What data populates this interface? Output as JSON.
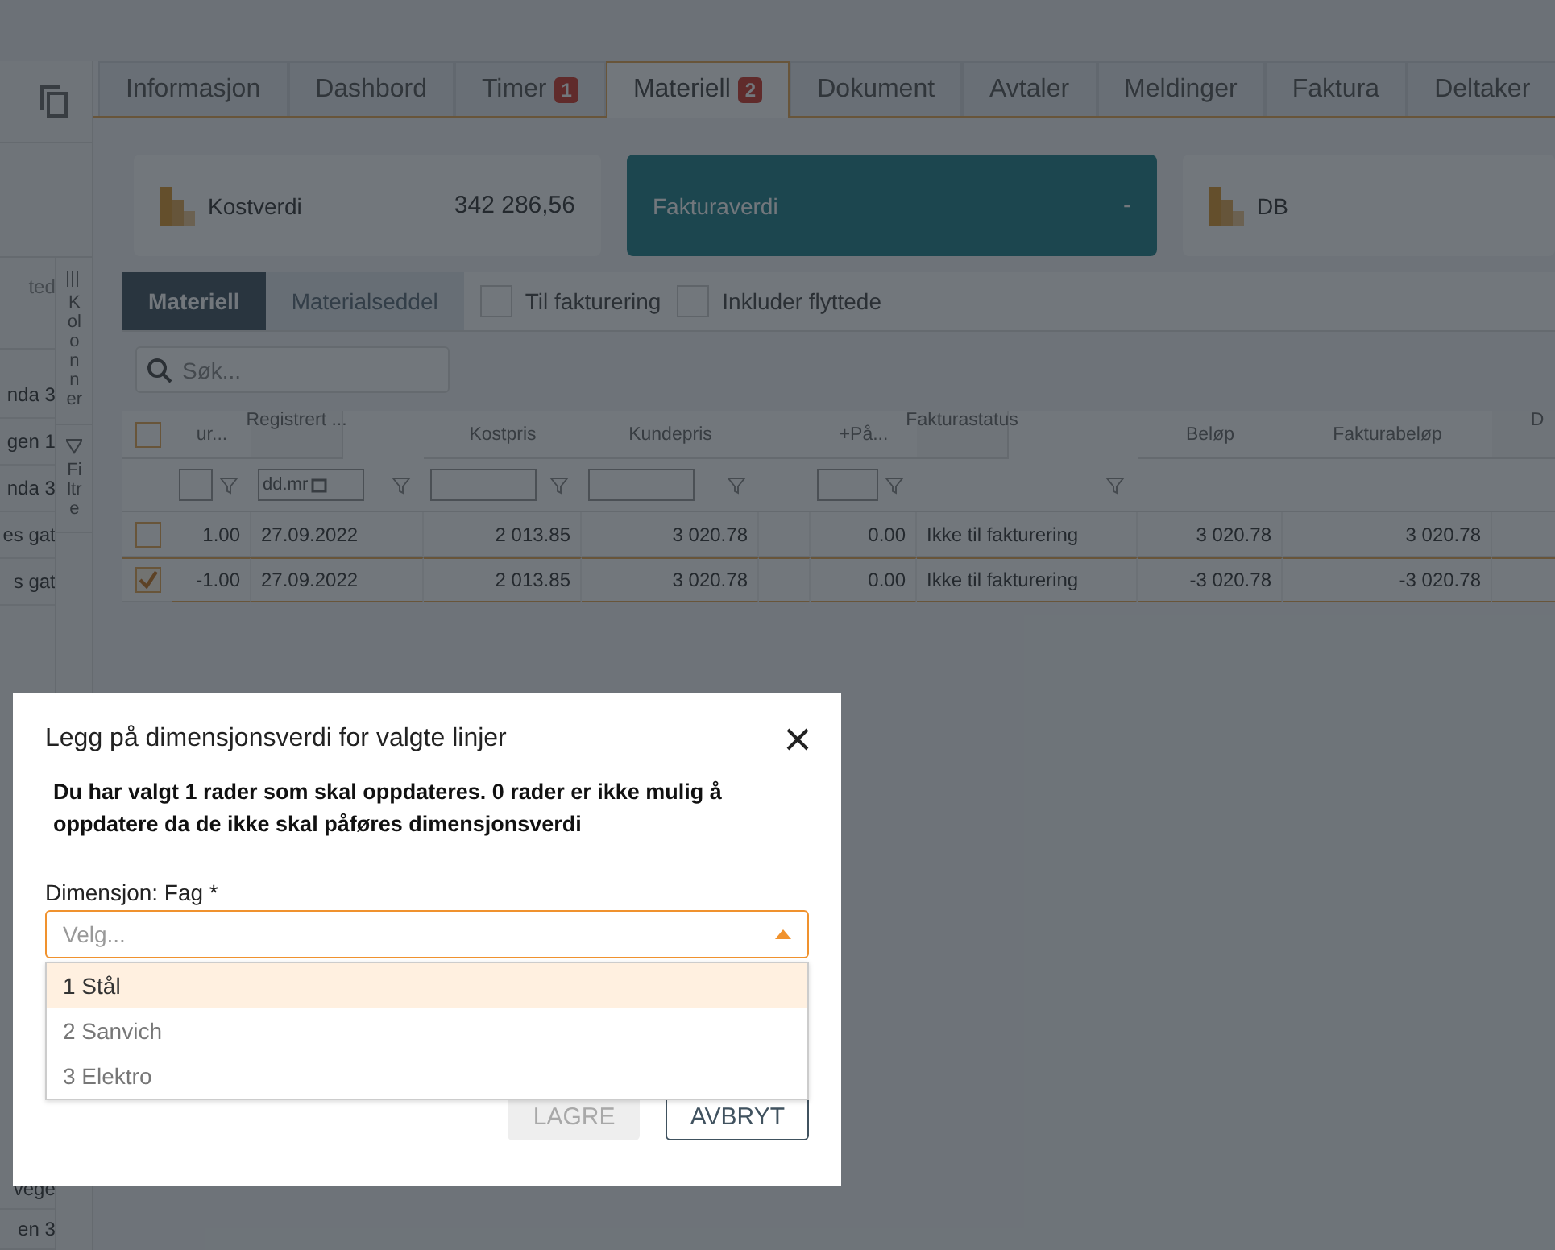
{
  "sidebar": {
    "header": "ted",
    "items": [
      "nda 3",
      "gen 1",
      "nda 3",
      "es gat",
      "s gat"
    ],
    "bottom_items": [
      "vege",
      "en 3"
    ],
    "side_tabs": [
      {
        "label": "Kolonner",
        "kind": "columns"
      },
      {
        "label": "Filtre",
        "kind": "filter"
      }
    ]
  },
  "tabs": [
    {
      "label": "Informasjon",
      "selected": false
    },
    {
      "label": "Dashbord",
      "selected": false
    },
    {
      "label": "Timer",
      "badge": "1",
      "selected": false
    },
    {
      "label": "Materiell",
      "badge": "2",
      "selected": true
    },
    {
      "label": "Dokument",
      "selected": false
    },
    {
      "label": "Avtaler",
      "selected": false
    },
    {
      "label": "Meldinger",
      "selected": false
    },
    {
      "label": "Faktura",
      "selected": false
    },
    {
      "label": "Deltaker",
      "selected": false
    }
  ],
  "summary_cards": [
    {
      "label": "Kostverdi",
      "value": "342 286,56",
      "kind": "plain"
    },
    {
      "label": "Fakturaverdi",
      "value": "-",
      "kind": "highlight"
    },
    {
      "label": "DB",
      "kind": "plain"
    }
  ],
  "sub_tabs": [
    {
      "label": "Materiell",
      "selected": true
    },
    {
      "label": "Materialseddel",
      "selected": false
    }
  ],
  "filters": [
    {
      "label": "Til fakturering",
      "checked": false
    },
    {
      "label": "Inkluder flyttede",
      "checked": false
    }
  ],
  "search": {
    "placeholder": "Søk..."
  },
  "table": {
    "select_all_checked": false,
    "columns": [
      {
        "label": "ur...",
        "kind": "text"
      },
      {
        "label": "Registrert ...",
        "kind": "date",
        "filter_placeholder": "dd.mr"
      },
      {
        "label": "Kostpris",
        "kind": "text"
      },
      {
        "label": "Kundepris",
        "kind": "text"
      },
      {
        "kind": "plain"
      },
      {
        "label": "+På...",
        "kind": "text"
      },
      {
        "label": "Fakturastatus",
        "kind": "funnel"
      },
      {
        "label": "Beløp",
        "kind": "plain"
      },
      {
        "label": "Fakturabeløp",
        "kind": "plain"
      },
      {
        "label": "D",
        "kind": "plain"
      }
    ],
    "rows": [
      {
        "checked": false,
        "selected": false,
        "cells": [
          "1.00",
          "27.09.2022",
          "2 013.85",
          "3 020.78",
          null,
          "0.00",
          "Ikke til fakturering",
          "3 020.78",
          "3 020.78",
          null
        ]
      },
      {
        "checked": true,
        "selected": true,
        "cells": [
          "-1.00",
          "27.09.2022",
          "2 013.85",
          "3 020.78",
          null,
          "0.00",
          "Ikke til fakturering",
          "-3 020.78",
          "-3 020.78",
          null
        ]
      }
    ]
  },
  "dialog": {
    "title": "Legg på dimensjonsverdi for valgte linjer",
    "message": "Du har valgt 1 rader som skal oppdateres. 0 rader er ikke mulig å oppdatere da de ikke skal påføres dimensjonsverdi",
    "field_label": "Dimensjon: Fag *",
    "placeholder": "Velg...",
    "expanded": true,
    "options": [
      {
        "label": "1 Stål",
        "selected": true
      },
      {
        "label": "2 Sanvich",
        "selected": false
      },
      {
        "label": "3 Elektro",
        "selected": false
      }
    ],
    "buttons": [
      {
        "label": "LAGRE",
        "disabled": true
      },
      {
        "label": "AVBRYT",
        "disabled": false
      }
    ]
  }
}
